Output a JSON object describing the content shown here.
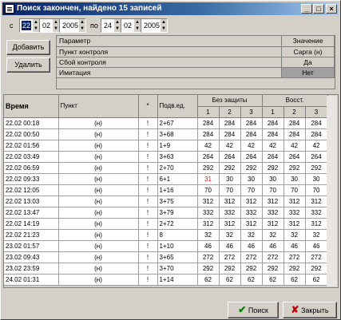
{
  "window": {
    "title": "Поиск закончен, найдено 15 записей"
  },
  "filter": {
    "from_label": "с",
    "to_label": "по",
    "from": {
      "day": "22",
      "month": "02",
      "year": "2005"
    },
    "to": {
      "day": "24",
      "month": "02",
      "year": "2005"
    }
  },
  "buttons": {
    "add": "Добавить",
    "remove": "Удалить",
    "search": "Поиск",
    "close": "Закрыть"
  },
  "params": {
    "header": {
      "name": "Параметр",
      "value": "Значение"
    },
    "rows": [
      {
        "name": "Пункт контроля",
        "value": "Сарга (н)"
      },
      {
        "name": "Сбой контроля",
        "value": "Да"
      },
      {
        "name": "Имитация",
        "value": "Нет"
      }
    ]
  },
  "table": {
    "headers": {
      "time": "Время",
      "punkt": "Пункт",
      "star": "*",
      "podv": "Подв.ед.",
      "bez": "Без защиты",
      "vosst": "Восст."
    },
    "subheaders": [
      "1",
      "2",
      "3",
      "1",
      "2",
      "3"
    ],
    "rows": [
      {
        "time": "22.02 00:18",
        "punkt": "(н)",
        "star": "!",
        "podv": "2+67",
        "v": [
          "284",
          "284",
          "284",
          "284",
          "284",
          "284"
        ]
      },
      {
        "time": "22.02 00:50",
        "punkt": "(н)",
        "star": "!",
        "podv": "3+68",
        "v": [
          "284",
          "284",
          "284",
          "284",
          "284",
          "284"
        ]
      },
      {
        "time": "22.02 01:56",
        "punkt": "(н)",
        "star": "!",
        "podv": "1+9",
        "v": [
          "42",
          "42",
          "42",
          "42",
          "42",
          "42"
        ]
      },
      {
        "time": "22.02 03:49",
        "punkt": "(н)",
        "star": "!",
        "podv": "3+63",
        "v": [
          "264",
          "264",
          "264",
          "264",
          "264",
          "264"
        ]
      },
      {
        "time": "22.02 06:59",
        "punkt": "(н)",
        "star": "!",
        "podv": "2+70",
        "v": [
          "292",
          "292",
          "292",
          "292",
          "292",
          "292"
        ]
      },
      {
        "time": "22.02 09:33",
        "punkt": "(н)",
        "star": "!",
        "podv": "6+1",
        "v": [
          "31",
          "30",
          "30",
          "30",
          "30",
          "30"
        ],
        "red": 0
      },
      {
        "time": "22.02 12:05",
        "punkt": "(н)",
        "star": "!",
        "podv": "1+16",
        "v": [
          "70",
          "70",
          "70",
          "70",
          "70",
          "70"
        ]
      },
      {
        "time": "22.02 13:03",
        "punkt": "(н)",
        "star": "!",
        "podv": "3+75",
        "v": [
          "312",
          "312",
          "312",
          "312",
          "312",
          "312"
        ]
      },
      {
        "time": "22.02 13:47",
        "punkt": "(н)",
        "star": "!",
        "podv": "3+79",
        "v": [
          "332",
          "332",
          "332",
          "332",
          "332",
          "332"
        ]
      },
      {
        "time": "22.02 14:19",
        "punkt": "(н)",
        "star": "!",
        "podv": "2+72",
        "v": [
          "312",
          "312",
          "312",
          "312",
          "312",
          "312"
        ]
      },
      {
        "time": "22.02 21:23",
        "punkt": "(н)",
        "star": "!",
        "podv": "8",
        "v": [
          "32",
          "32",
          "32",
          "32",
          "32",
          "32"
        ]
      },
      {
        "time": "23.02 01:57",
        "punkt": "(н)",
        "star": "!",
        "podv": "1+10",
        "v": [
          "46",
          "46",
          "46",
          "46",
          "46",
          "46"
        ]
      },
      {
        "time": "23.02 09:43",
        "punkt": "(н)",
        "star": "!",
        "podv": "3+65",
        "v": [
          "272",
          "272",
          "272",
          "272",
          "272",
          "272"
        ]
      },
      {
        "time": "23.02 23:59",
        "punkt": "(н)",
        "star": "!",
        "podv": "3+70",
        "v": [
          "292",
          "292",
          "292",
          "292",
          "292",
          "292"
        ]
      },
      {
        "time": "24.02 01:31",
        "punkt": "(н)",
        "star": "!",
        "podv": "1+14",
        "v": [
          "62",
          "62",
          "62",
          "62",
          "62",
          "62"
        ]
      }
    ]
  }
}
